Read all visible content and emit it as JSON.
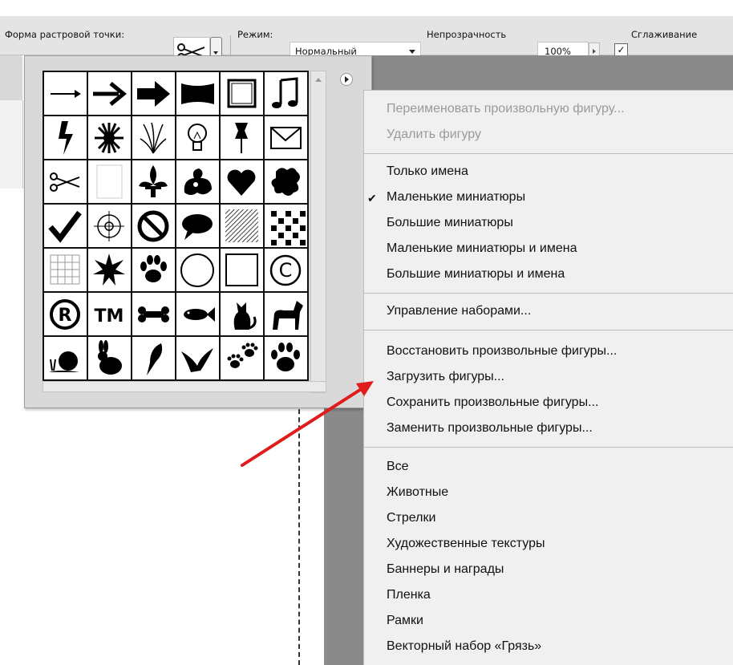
{
  "options_bar": {
    "brush_shape_label": "Форма растровой точки:",
    "mode_label": "Режим:",
    "mode_value": "Нормальный",
    "opacity_label": "Непрозрачность",
    "opacity_value": "100%",
    "antialias_checkbox_mark": "✓",
    "antialias_label": "Сглаживание"
  },
  "shapes_panel": {
    "shapes": [
      "thin-arrow",
      "bold-arrow",
      "heavy-arrow",
      "banner",
      "frame",
      "music-note",
      "lightning",
      "starburst",
      "grass",
      "lightbulb",
      "pushpin",
      "envelope",
      "scissors",
      "blank-page",
      "fleur-de-lis",
      "ornament",
      "heart",
      "puzzle-blot",
      "checkmark",
      "target",
      "no-sign",
      "speech-bubble",
      "hatch",
      "diamond-grid",
      "grid",
      "burst",
      "paw",
      "circle-frame",
      "square-frame",
      "copyright",
      "registered",
      "trademark",
      "bone",
      "fish",
      "cat",
      "dog",
      "snail",
      "rabbit",
      "bird",
      "dove",
      "paw-prints",
      "paw-print"
    ]
  },
  "context_menu": {
    "group1": [
      {
        "label": "Переименовать произвольную фигуру...",
        "disabled": true
      },
      {
        "label": "Удалить фигуру",
        "disabled": true
      }
    ],
    "group2": [
      {
        "label": "Только имена"
      },
      {
        "label": "Маленькие миниатюры",
        "checked": true,
        "check_mark": "✔"
      },
      {
        "label": "Большие миниатюры"
      },
      {
        "label": "Маленькие миниатюры и имена"
      },
      {
        "label": "Большие миниатюры и имена"
      }
    ],
    "group3": [
      {
        "label": "Управление наборами..."
      }
    ],
    "group4": [
      {
        "label": "Восстановить произвольные фигуры..."
      },
      {
        "label": "Загрузить фигуры..."
      },
      {
        "label": "Сохранить произвольные фигуры..."
      },
      {
        "label": "Заменить произвольные фигуры..."
      }
    ],
    "group5": [
      {
        "label": "Все"
      },
      {
        "label": "Животные"
      },
      {
        "label": "Стрелки"
      },
      {
        "label": "Художественные текстуры"
      },
      {
        "label": "Баннеры и награды"
      },
      {
        "label": "Пленка"
      },
      {
        "label": "Рамки"
      },
      {
        "label": "Векторный набор «Грязь»"
      }
    ]
  },
  "annotation": {
    "arrow_color": "#e01b1b"
  }
}
